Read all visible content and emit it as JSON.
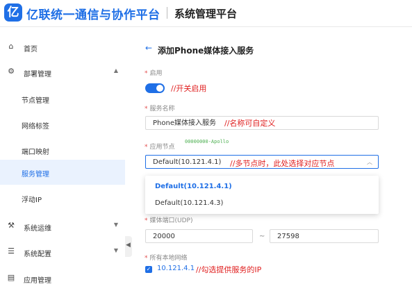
{
  "header": {
    "logo_glyph": "亿",
    "brand": "亿联统一通信与协作平台",
    "title": "系统管理平台"
  },
  "sidebar": {
    "items": [
      {
        "label": "首页",
        "icon": "home-icon"
      },
      {
        "label": "部署管理",
        "icon": "gear-icon",
        "expanded": true
      },
      {
        "label": "节点管理"
      },
      {
        "label": "网络标签"
      },
      {
        "label": "端口映射"
      },
      {
        "label": "服务管理",
        "active": true
      },
      {
        "label": "浮动IP"
      },
      {
        "label": "系统运维",
        "icon": "wrench-icon"
      },
      {
        "label": "系统配置",
        "icon": "config-icon"
      },
      {
        "label": "应用管理",
        "icon": "app-icon"
      }
    ],
    "collapse_glyph": "◀"
  },
  "main": {
    "back_glyph": "←",
    "page_title": "添加Phone媒体接入服务",
    "enable": {
      "label": "启用",
      "on": true,
      "note": "//开关启用"
    },
    "service_name": {
      "label": "服务名称",
      "value": "Phone媒体接入服务",
      "note": "//名称可自定义"
    },
    "app_node": {
      "label": "应用节点",
      "tag": "00000000-Apollo",
      "value": "Default(10.121.4.1)",
      "note": "//多节点时，此处选择对应节点",
      "options": [
        "Default(10.121.4.1)",
        "Default(10.121.4.3)"
      ]
    },
    "media_port": {
      "label": "媒体端口(UDP)",
      "from": "20000",
      "sep": "~",
      "to": "27598"
    },
    "local_network": {
      "label": "所有本地网络",
      "checked_ip": "10.121.4.1",
      "note": "//勾选提供服务的IP"
    },
    "required_mark": "*"
  },
  "colors": {
    "accent": "#1f6fe6",
    "note": "#e02020",
    "active_bg": "#eaf2fe"
  }
}
